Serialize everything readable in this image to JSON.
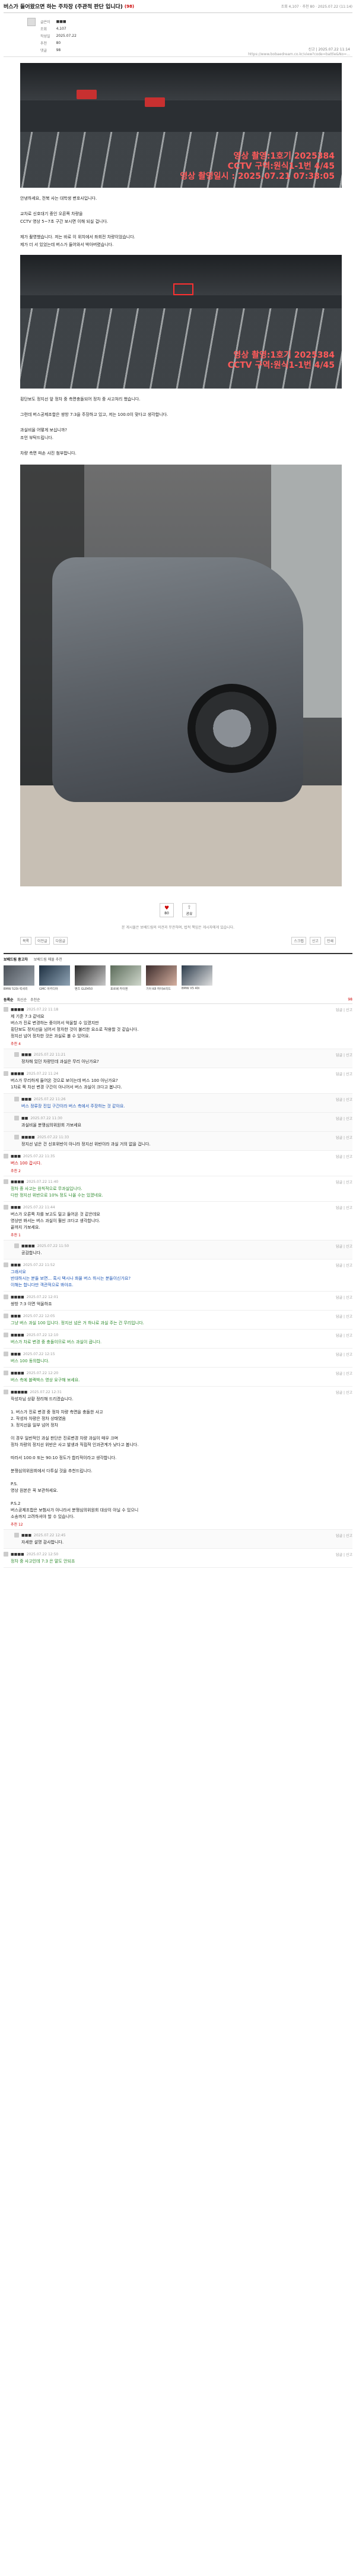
{
  "post": {
    "title": "버스가 들어왔으면 하는 주차장 (주관적 판단 입니다)",
    "badge": "(98)",
    "top_right": "조회 4,107 · 추천 80 · 2025.07.22 (11:14)",
    "meta": [
      {
        "k": "글쓴이",
        "v": "■■■"
      },
      {
        "k": "조회",
        "v": "4,107"
      },
      {
        "k": "작성일",
        "v": "2025.07.22"
      },
      {
        "k": "추천",
        "v": "80"
      },
      {
        "k": "댓글",
        "v": "98"
      }
    ],
    "meta_right": "신고 | 2025.07.22 11:14",
    "meta_url": "https://www.bobaedream.co.kr/view?code=battle&No=..."
  },
  "cctv1": {
    "caption": [
      "영상 촬영:1호기 2025384",
      "CCTV 구역:원식1-1번 4/45",
      "영상 촬영일시 : 2025.07.21 07:38:05"
    ]
  },
  "text1": [
    "안녕하세요, 전북 사는 대학생 변호사입니다.",
    "",
    "교차로 신호대기 중인 오른쪽 차량을",
    "CCTV 영상 5~7초 구간 보시면 이해 되실 겁니다.",
    "",
    "제가 촬영했습니다. 저는 바로 이 위치에서 좌회전 차량이었습니다.",
    "제가 더 서 있었는데 버스가 들어와서 박아버렸습니다."
  ],
  "cctv2": {
    "caption": [
      "영상 촬영:1호기 2025384",
      "CCTV 구역:원식1-1번 4/45"
    ]
  },
  "text2": [
    "횡단보도 정지선 앞 정차 중 측면충돌되어 정차 중 사고처리 했습니다.",
    "",
    "그런데 버스공제조합은 쌍방 7:3을 주장하고 있고, 저는 100:0이 맞다고 생각합니다.",
    "",
    "과실비율 어떻게 보십니까?",
    "조언 부탁드립니다.",
    "",
    "차량 측면 파손 사진 첨부합니다."
  ],
  "buttons": {
    "like_label": "추천",
    "like_count": "80",
    "share_label": "공유"
  },
  "notice": "본 게시물은 보배드림의 의견과 무관하며, 법적 책임은 게시자에게 있습니다.",
  "tools": {
    "left": [
      "목록",
      "이전글",
      "다음글"
    ],
    "right": [
      "스크랩",
      "신고",
      "인쇄"
    ]
  },
  "banner": {
    "title": "보배드림 중고차",
    "sub": "보배드림 매물 추천",
    "items": [
      "BMW 520i 럭셔리",
      "GMC 아카디아",
      "벤츠 GLE450",
      "포르쉐 카이엔",
      "기아 K8 하이브리드",
      "BMW X5 40i"
    ]
  },
  "comments_header": {
    "tabs": [
      "등록순",
      "최신순",
      "추천순"
    ],
    "total": "98"
  },
  "comments": [
    {
      "nick": "■■■■",
      "date": "2025.07.22 11:18",
      "right": "답글 | 신고",
      "reply": false,
      "color": "",
      "lines": [
        "제 기준 7:3 같네요",
        "버스가 진로 변경하는 중이어서 억울할 수 있겠지만",
        "횡단보도 정지선을 넘어서 정차한 것이 불리한 요소로 작용할 것 같습니다.",
        "정지선 넘어 정차한 것은 과실로 볼 수 있어요."
      ],
      "like": "추천 4"
    },
    {
      "nick": "■■■",
      "date": "2025.07.22 11:21",
      "right": "답글 | 신고",
      "reply": true,
      "color": "",
      "lines": [
        "정차해 있던 차량인데 과실은 무리 아닌가요?"
      ],
      "like": ""
    },
    {
      "nick": "■■■■",
      "date": "2025.07.22 11:24",
      "right": "답글 | 신고",
      "reply": false,
      "color": "",
      "lines": [
        "버스가 무리하게 들어온 것으로 보이는데 버스 100 아닌가요?",
        "1차로 쪽 차선 변경 구간이 아니어서 버스 과실이 크다고 봅니다."
      ],
      "like": ""
    },
    {
      "nick": "■■■",
      "date": "2025.07.22 11:26",
      "right": "답글 | 신고",
      "reply": true,
      "color": "blue",
      "lines": [
        "버스 정류장 진입 구간이라 버스 측에서 주장하는 것 같아요."
      ],
      "like": ""
    },
    {
      "nick": "■■",
      "date": "2025.07.22 11:30",
      "right": "답글 | 신고",
      "reply": true,
      "color": "",
      "lines": [
        "과실비율 분쟁심의위원회 가보세요"
      ],
      "like": ""
    },
    {
      "nick": "■■■■",
      "date": "2025.07.22 11:33",
      "right": "답글 | 신고",
      "reply": true,
      "color": "",
      "lines": [
        "정지선 넘은 건 신호위반이 아니라 정지선 위반이라 과실 거의 없을 겁니다."
      ],
      "like": ""
    },
    {
      "nick": "■■■",
      "date": "2025.07.22 11:35",
      "right": "답글 | 신고",
      "reply": false,
      "color": "red",
      "lines": [
        "버스 100 갑시다."
      ],
      "like": "추천 2"
    },
    {
      "nick": "■■■■",
      "date": "2025.07.22 11:40",
      "right": "답글 | 신고",
      "reply": false,
      "color": "green",
      "lines": [
        "정차 중 사고는 원칙적으로 무과실입니다.",
        "다만 정지선 위반으로 10% 정도 나올 수는 있겠네요."
      ],
      "like": ""
    },
    {
      "nick": "■■■",
      "date": "2025.07.22 11:44",
      "right": "답글 | 신고",
      "reply": false,
      "color": "",
      "lines": [
        "버스가 오른쪽 차를 보고도 밀고 들어온 것 같은데요",
        "영상만 봐서는 버스 과실이 훨씬 크다고 생각합니다.",
        "끝까지 가보세요."
      ],
      "like": "추천 1"
    },
    {
      "nick": "■■■■",
      "date": "2025.07.22 11:50",
      "right": "답글 | 신고",
      "reply": true,
      "color": "",
      "lines": [
        "공감합니다."
      ],
      "like": ""
    },
    {
      "nick": "■■■",
      "date": "2025.07.22 11:52",
      "right": "답글 | 신고",
      "reply": false,
      "color": "blue",
      "lines": [
        "그래서요",
        "반대하시는 분들 보면... 혹시 택시나 화물 버스 하시는 분들이신가요?",
        "이해는 합니다만 객관적으로 봐야죠."
      ],
      "like": ""
    },
    {
      "nick": "■■■■",
      "date": "2025.07.22 12:01",
      "right": "답글 | 신고",
      "reply": false,
      "color": "",
      "lines": [
        "쌍방 7:3 이면 억울하죠"
      ],
      "like": ""
    },
    {
      "nick": "■■■",
      "date": "2025.07.22 12:05",
      "right": "답글 | 신고",
      "reply": false,
      "color": "green",
      "lines": [
        "그냥 버스 과실 100 입니다. 정지선 넘은 거 하나로 과실 주는 건 무리입니다."
      ],
      "like": ""
    },
    {
      "nick": "■■■■",
      "date": "2025.07.22 12:10",
      "right": "답글 | 신고",
      "reply": false,
      "color": "green",
      "lines": [
        "버스가 차로 변경 중 충돌이므로 버스 과실이 큽니다."
      ],
      "like": ""
    },
    {
      "nick": "■■■",
      "date": "2025.07.22 12:15",
      "right": "답글 | 신고",
      "reply": false,
      "color": "green",
      "lines": [
        "버스 100 동의합니다."
      ],
      "like": ""
    },
    {
      "nick": "■■■■",
      "date": "2025.07.22 12:20",
      "right": "답글 | 신고",
      "reply": false,
      "color": "green",
      "lines": [
        "버스 측에 블랙박스 영상 요구해 보세요."
      ],
      "like": ""
    },
    {
      "nick": "■■■■■",
      "date": "2025.07.22 12:31",
      "right": "답글 | 신고",
      "reply": false,
      "color": "",
      "lines": [
        "작성자님 상황 정리해 드리겠습니다.",
        "",
        "1. 버스가 진로 변경 중 정차 차량 측면을 충돌한 사고",
        "2. 작성자 차량은 정차 상태였음",
        "3. 정지선을 일부 넘어 정차",
        "",
        "이 경우 일반적인 과실 판단은 진로변경 차량 과실이 매우 크며",
        "정차 차량의 정지선 위반은 사고 발생과 직접적 인과관계가 낮다고 봅니다.",
        "",
        "따라서 100:0 또는 90:10 정도가 합리적이라고 생각합니다.",
        "",
        "분쟁심의위원회에서 다투실 것을 추천드립니다.",
        "",
        "P.S.",
        "영상 원본은 꼭 보관하세요.",
        "",
        "P.S.2",
        "버스공제조합은 보험사가 아니라서 분쟁심의위원회 대상이 아닐 수 있으니",
        "소송까지 고려하셔야 할 수 있습니다."
      ],
      "like": "추천 12"
    },
    {
      "nick": "■■■",
      "date": "2025.07.22 12:45",
      "right": "답글 | 신고",
      "reply": true,
      "color": "",
      "lines": [
        "자세한 설명 감사합니다."
      ],
      "like": ""
    },
    {
      "nick": "■■■■",
      "date": "2025.07.22 12:50",
      "right": "답글 | 신고",
      "reply": false,
      "color": "green",
      "lines": [
        "정차 중 사고인데 7:3 은 말도 안되죠"
      ],
      "like": ""
    }
  ]
}
